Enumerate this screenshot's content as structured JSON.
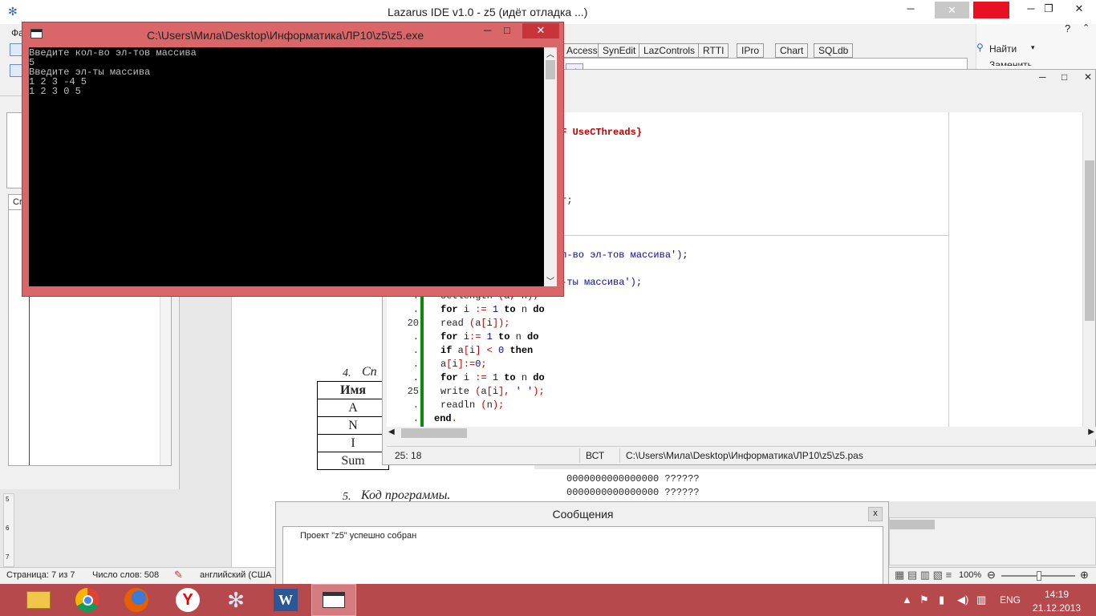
{
  "lazarus": {
    "title": "Lazarus IDE v1.0 - z5 (идёт отладка ...)",
    "menu_first": "Фа",
    "palette_tabs": [
      "Access",
      "SynEdit",
      "LazControls",
      "RTTI",
      "IPro",
      "Chart",
      "SQLdb"
    ],
    "find_label": "Найти",
    "replace_label": "Заменить"
  },
  "left_panel": {
    "tab_fragment": "Сп"
  },
  "editor": {
    "top_lines": [
      {
        "text": "EF UseCThreads}",
        "style": "sym"
      },
      {
        "text": "er;",
        "style": "plain"
      },
      {
        "text": "ол-во эл-тов массива');",
        "style": "str"
      },
      {
        "text": "л-ты массива');",
        "style": "str"
      }
    ],
    "line_numbers": [
      ".",
      ".",
      "20",
      ".",
      ".",
      ".",
      ".",
      "25",
      ".",
      "."
    ],
    "code_lines": [
      "setlength (a, n);",
      "for i := 1 to n do",
      "read (a[i]);",
      "for i:= 1 to n do",
      "if a[i] < 0 then",
      "a[i]:=0;",
      "for i := 1 to n do",
      "write (a[i], ' ');",
      "readln (n);",
      "end."
    ],
    "status_pos": "25:  18",
    "status_mode": "ВСТ",
    "status_file": "C:\\Users\\Мила\\Desktop\\Информатика\\ЛР10\\z5\\z5.pas"
  },
  "console": {
    "title": "C:\\Users\\Мила\\Desktop\\Информатика\\ЛР10\\z5\\z5.exe",
    "lines": [
      "Введите кол-во эл-тов массива",
      "5",
      "Введите эл-ты массива",
      "1 2 3 -4 5",
      "1 2 3 0 5"
    ]
  },
  "word_doc": {
    "item4_num": "4.",
    "item4_text": "Сп",
    "table_header": "Имя",
    "table_rows": [
      "A",
      "N",
      "I",
      "Sum"
    ],
    "item5_num": "5.",
    "item5_text": "Код программы.",
    "ruler_marks": [
      "5",
      "6",
      "7"
    ],
    "right_text_lines": [
      "0000000000000000  ??????",
      "0000000000000000  ??????"
    ],
    "status_page": "Страница: 7 из 7",
    "status_words": "Число слов: 508",
    "status_lang": "английский (США",
    "zoom": "100%"
  },
  "messages": {
    "title": "Сообщения",
    "close": "x",
    "text": "Проект \"z5\" успешно собран"
  },
  "taskbar": {
    "lang": "ENG",
    "time": "14:19",
    "date": "21.12.2013"
  }
}
